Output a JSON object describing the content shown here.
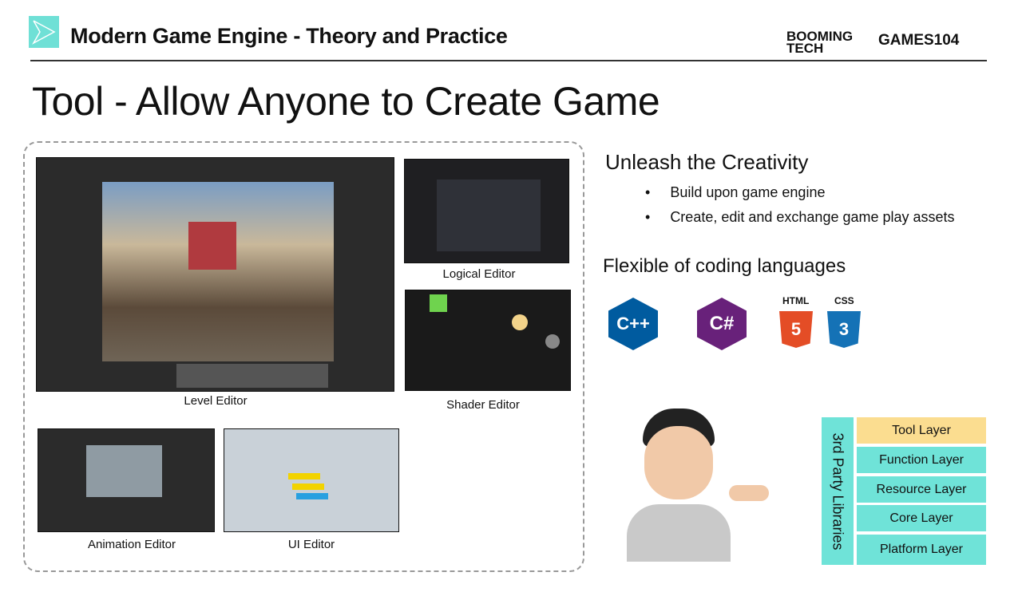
{
  "header": {
    "title": "Modern Game Engine - Theory and Practice",
    "brand1": "BOOMING TECH",
    "brand2": "GAMES104"
  },
  "slide_title": "Tool - Allow Anyone to Create Game",
  "screenshots": {
    "level": "Level Editor",
    "logical": "Logical Editor",
    "shader": "Shader Editor",
    "animation": "Animation Editor",
    "ui": "UI Editor"
  },
  "creativity": {
    "heading": "Unleash the Creativity",
    "bullets": [
      "Build upon game engine",
      "Create, edit and exchange game play assets"
    ]
  },
  "languages": {
    "heading": "Flexible of coding languages",
    "items": [
      {
        "name": "C++",
        "color": "#005b9f"
      },
      {
        "name": "C#",
        "color": "#68217a"
      },
      {
        "name": "HTML",
        "label": "HTML",
        "color": "#e44d26"
      },
      {
        "name": "CSS",
        "label": "CSS",
        "color": "#1572b6"
      }
    ]
  },
  "layers": {
    "side": "3rd Party Libraries",
    "items": [
      "Tool Layer",
      "Function Layer",
      "Resource Layer",
      "Core Layer",
      "Platform Layer"
    ],
    "highlight_color": "#fbdd90",
    "color": "#6fe3d8"
  }
}
